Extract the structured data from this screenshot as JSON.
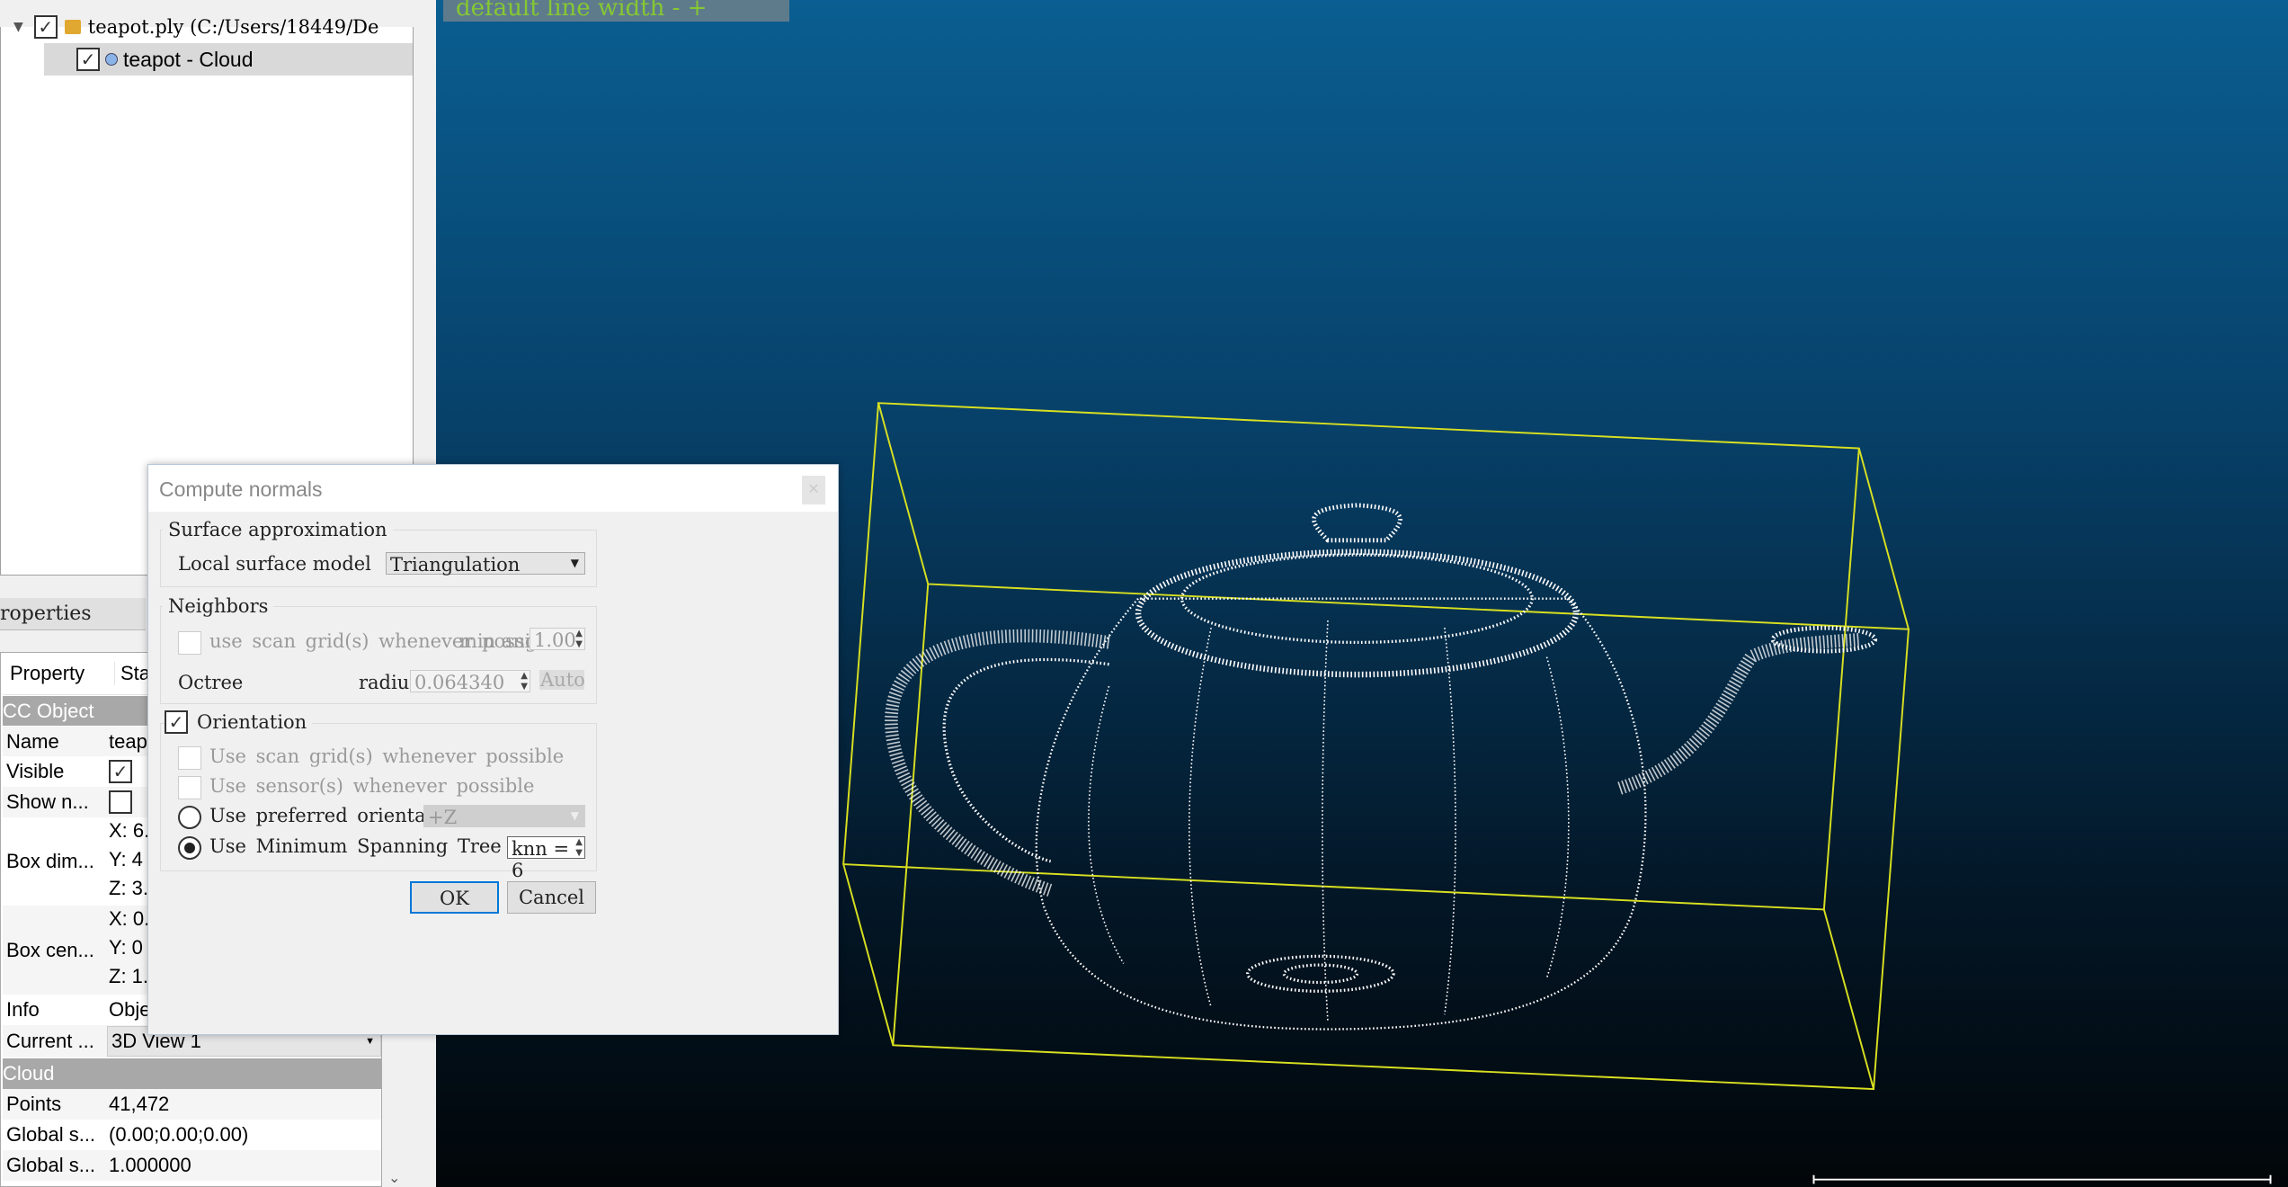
{
  "tree": {
    "root_label": "teapot.ply (C:/Users/18449/De",
    "child_label": "teapot - Cloud"
  },
  "viewport": {
    "overlay_text": "default line width - +",
    "box_color": "#d8e020",
    "points_color": "#ffffff"
  },
  "properties": {
    "header": "roperties",
    "col_property": "Property",
    "col_state": "Stat",
    "section_cc": "CC Object",
    "rows": [
      {
        "k": "Name",
        "v": "teap"
      },
      {
        "k": "Visible",
        "v": ""
      },
      {
        "k": "Show n...",
        "v": ""
      },
      {
        "k": "Box dim...",
        "v1": "X: 6.",
        "v2": "Y: 4",
        "v3": "Z: 3."
      },
      {
        "k": "Box cen...",
        "v1": "X: 0.",
        "v2": "Y: 0",
        "v3": "Z: 1."
      },
      {
        "k": "Info",
        "v": "Obje"
      },
      {
        "k": "Current ...",
        "v": "3D View 1"
      }
    ],
    "section_cloud": "Cloud",
    "cloud_rows": [
      {
        "k": "Points",
        "v": "41,472"
      },
      {
        "k": "Global s...",
        "v": "(0.00;0.00;0.00)"
      },
      {
        "k": "Global s...",
        "v": "1.000000"
      }
    ]
  },
  "dialog": {
    "title": "Compute normals",
    "surface": {
      "title": "Surface approximation",
      "model_label": "Local surface model",
      "model_value": "Triangulation"
    },
    "neighbors": {
      "title": "Neighbors",
      "scan_grid_label": "use scan grid(s) whenever possible",
      "min_angle_label": "min angle",
      "min_angle_value": "1.00",
      "octree_label": "Octree",
      "radius_label": "radius",
      "radius_value": "0.064340",
      "auto_label": "Auto"
    },
    "orientation": {
      "title": "Orientation",
      "checked": true,
      "scan_grid_label": "Use scan grid(s)  whenever possible",
      "sensor_label": "Use sensor(s) whenever possible",
      "preferred_label": "Use preferred orientation",
      "preferred_value": "+Z",
      "mst_label": "Use Minimum Spanning Tree",
      "knn_value": "knn = 6",
      "selected": "mst"
    },
    "ok_label": "OK",
    "cancel_label": "Cancel"
  }
}
